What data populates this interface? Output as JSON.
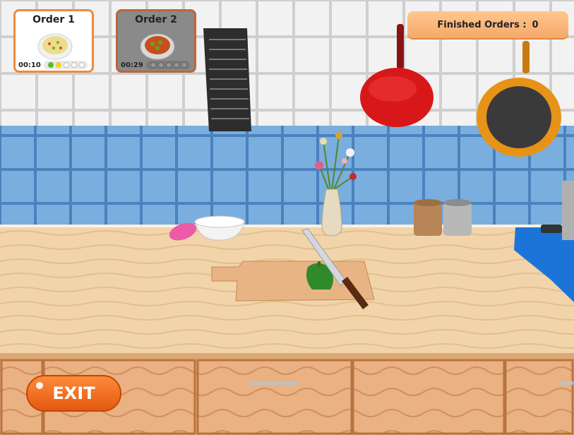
{
  "orders": [
    {
      "title": "Order 1",
      "time": "00:10",
      "dish": "fried-rice-bowl-icon",
      "progress": 2,
      "total": 5
    },
    {
      "title": "Order 2",
      "time": "00:29",
      "dish": "curry-bowl-icon",
      "progress": 0,
      "total": 5
    }
  ],
  "finished": {
    "label": "Finished Orders :",
    "count": "0"
  },
  "exit_label": "EXIT",
  "colors": {
    "accent": "#f08a3c",
    "progress_green": "#5ab82d",
    "progress_yellow": "#f2d21e",
    "exit": "#f07020"
  }
}
